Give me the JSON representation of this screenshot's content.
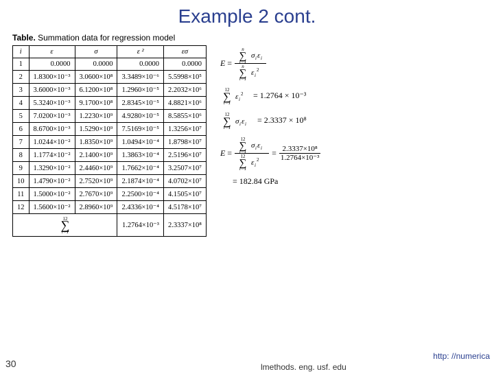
{
  "title": "Example 2 cont.",
  "caption_strong": "Table.",
  "caption_rest": " Summation data for regression model",
  "headers": {
    "h0": "i",
    "h1": "ε",
    "h2": "σ",
    "h3": "ε ²",
    "h4": "εσ"
  },
  "rows": [
    {
      "i": "1",
      "eps": "0.0000",
      "sig": "0.0000",
      "eps2": "0.0000",
      "prod": "0.0000"
    },
    {
      "i": "2",
      "eps": "1.8300×10⁻³",
      "sig": "3.0600×10⁸",
      "eps2": "3.3489×10⁻⁶",
      "prod": "5.5998×10⁵"
    },
    {
      "i": "3",
      "eps": "3.6000×10⁻³",
      "sig": "6.1200×10⁸",
      "eps2": "1.2960×10⁻⁵",
      "prod": "2.2032×10⁶"
    },
    {
      "i": "4",
      "eps": "5.3240×10⁻³",
      "sig": "9.1700×10⁸",
      "eps2": "2.8345×10⁻⁵",
      "prod": "4.8821×10⁶"
    },
    {
      "i": "5",
      "eps": "7.0200×10⁻³",
      "sig": "1.2230×10⁹",
      "eps2": "4.9280×10⁻⁵",
      "prod": "8.5855×10⁶"
    },
    {
      "i": "6",
      "eps": "8.6700×10⁻³",
      "sig": "1.5290×10⁹",
      "eps2": "7.5169×10⁻⁵",
      "prod": "1.3256×10⁷"
    },
    {
      "i": "7",
      "eps": "1.0244×10⁻²",
      "sig": "1.8350×10⁹",
      "eps2": "1.0494×10⁻⁴",
      "prod": "1.8798×10⁷"
    },
    {
      "i": "8",
      "eps": "1.1774×10⁻²",
      "sig": "2.1400×10⁹",
      "eps2": "1.3863×10⁻⁴",
      "prod": "2.5196×10⁷"
    },
    {
      "i": "9",
      "eps": "1.3290×10⁻²",
      "sig": "2.4460×10⁹",
      "eps2": "1.7662×10⁻⁴",
      "prod": "3.2507×10⁷"
    },
    {
      "i": "10",
      "eps": "1.4790×10⁻²",
      "sig": "2.7520×10⁹",
      "eps2": "2.1874×10⁻⁴",
      "prod": "4.0702×10⁷"
    },
    {
      "i": "11",
      "eps": "1.5000×10⁻²",
      "sig": "2.7670×10⁹",
      "eps2": "2.2500×10⁻⁴",
      "prod": "4.1505×10⁷"
    },
    {
      "i": "12",
      "eps": "1.5600×10⁻²",
      "sig": "2.8960×10⁹",
      "eps2": "2.4336×10⁻⁴",
      "prod": "4.5178×10⁷"
    }
  ],
  "sum": {
    "eps2": "1.2764×10⁻³",
    "prod": "2.3337×10⁸",
    "lower": "i=1",
    "upper": "12"
  },
  "equations": {
    "eq1_lhs": "E = ",
    "sum_n_top": "n",
    "sum_lower": "i=1",
    "sig_eps": "σᵢεᵢ",
    "eps_sq": "εᵢ²",
    "eq2_rhs": " = 1.2764 × 10⁻³",
    "eq3_rhs": " = 2.3337 × 10⁸",
    "eq4_lhs": "E = ",
    "eq4_final1": " = ",
    "eq4_val1": "2.3337×10⁸",
    "eq4_val2": "1.2764×10⁻³",
    "eq5": "= 182.84 GPa",
    "twelve": "12"
  },
  "slide_number": "30",
  "link_text": "http: //numerica",
  "url_text": "lmethods. eng. usf. edu"
}
